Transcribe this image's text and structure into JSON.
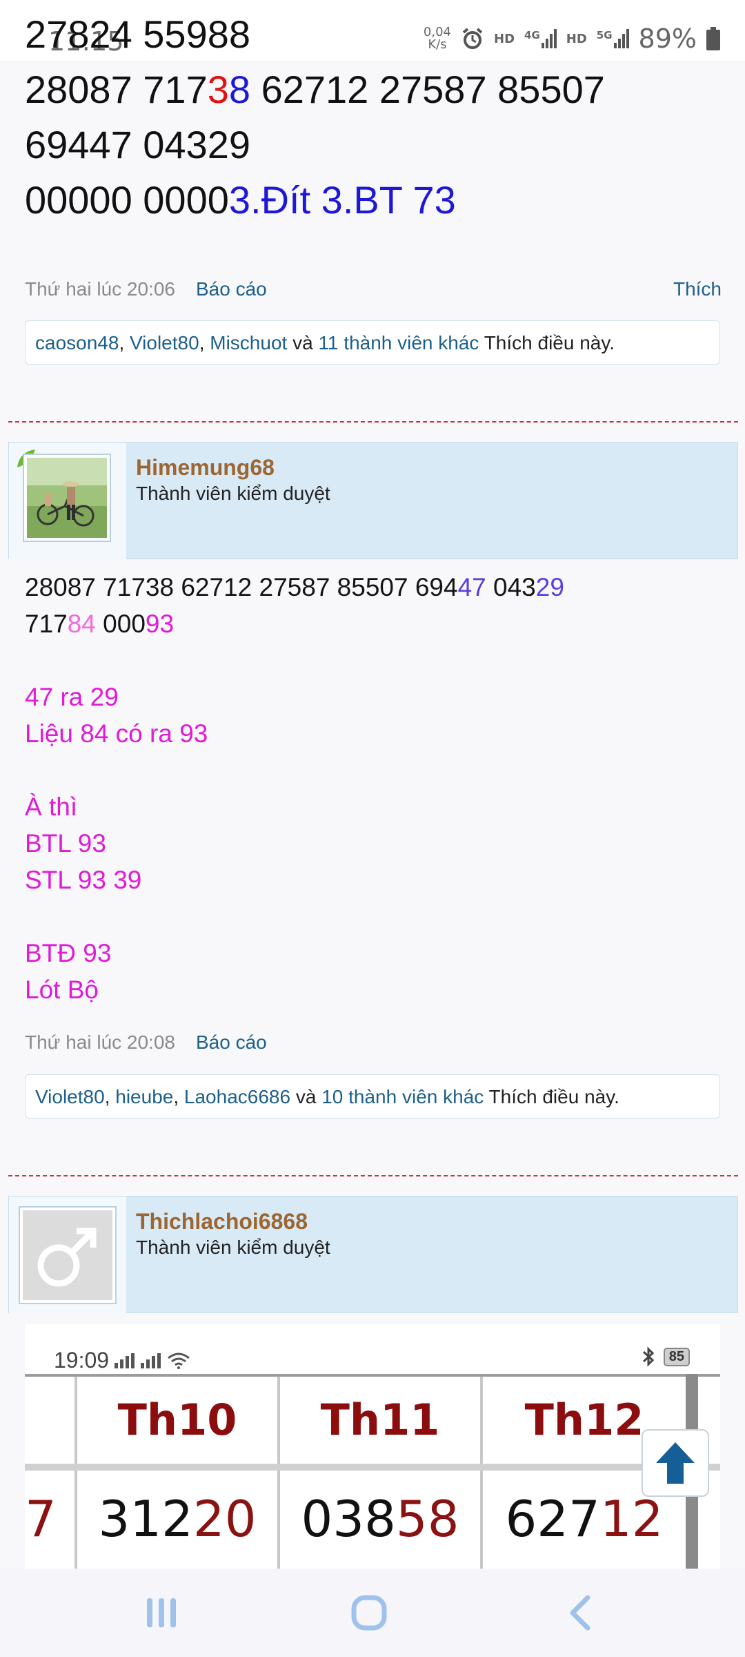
{
  "status_bar": {
    "time": "11:15",
    "net_speed_value": "0,04",
    "net_speed_unit": "K/s",
    "hd1": "HD",
    "net1": "4G",
    "hd2": "HD",
    "net2": "5G",
    "battery": "89%"
  },
  "post1": {
    "line0": "27824 55988",
    "line1_a": "28087 717",
    "line1_red": "3",
    "line1_blue": "8",
    "line1_b": " 62712 27587 85507",
    "line2": "69447 04329",
    "line3_a": "00000 0000",
    "line3_blue": "3.Đít 3.BT 73",
    "timestamp": "Thứ hai lúc 20:06",
    "report": "Báo cáo",
    "like": "Thích",
    "likers": {
      "u1": "caoson48",
      "sep1": ", ",
      "u2": "Violet80",
      "sep2": ", ",
      "u3": "Mischuot",
      "and": " và ",
      "others": "11 thành viên khác",
      "suffix": " Thích điều này."
    }
  },
  "post2": {
    "username": "Himemung68",
    "user_title": "Thành viên kiểm duyệt",
    "l1_a": "28087 71738 62712 27587 85507 694",
    "l1_p1": "47",
    "l1_b": " 043",
    "l1_p2": "29",
    "l2_a": "717",
    "l2_pink": "84",
    "l2_b": " 000",
    "l2_mag": "93",
    "m1": "47 ra 29",
    "m2": "Liệu 84 có ra 93",
    "m3": "À thì",
    "m4": "BTL 93",
    "m5": "STL 93 39",
    "m6": "BTĐ 93",
    "m7": "Lót Bộ",
    "timestamp": "Thứ hai lúc 20:08",
    "report": "Báo cáo",
    "likers": {
      "u1": "Violet80",
      "sep1": ", ",
      "u2": "hieube",
      "sep2": ", ",
      "u3": "Laohac6686",
      "and": " và ",
      "others": "10 thành viên khác",
      "suffix": " Thích điều này."
    }
  },
  "post3": {
    "username": "Thichlachoi6868",
    "user_title": "Thành viên kiểm duyệt",
    "embed": {
      "time": "19:09",
      "battery": "85",
      "col0_value_tail": "7",
      "headers": [
        "Th10",
        "Th11",
        "Th12"
      ],
      "v1_a": "312",
      "v1_b": "20",
      "v2_a": "038",
      "v2_b": "58",
      "v3_a": "627",
      "v3_b": "12"
    }
  },
  "colors": {
    "accent_link": "#1c5f8a",
    "username": "#9b6631",
    "magenta": "#e01ad6",
    "divider": "#c23a3a"
  }
}
